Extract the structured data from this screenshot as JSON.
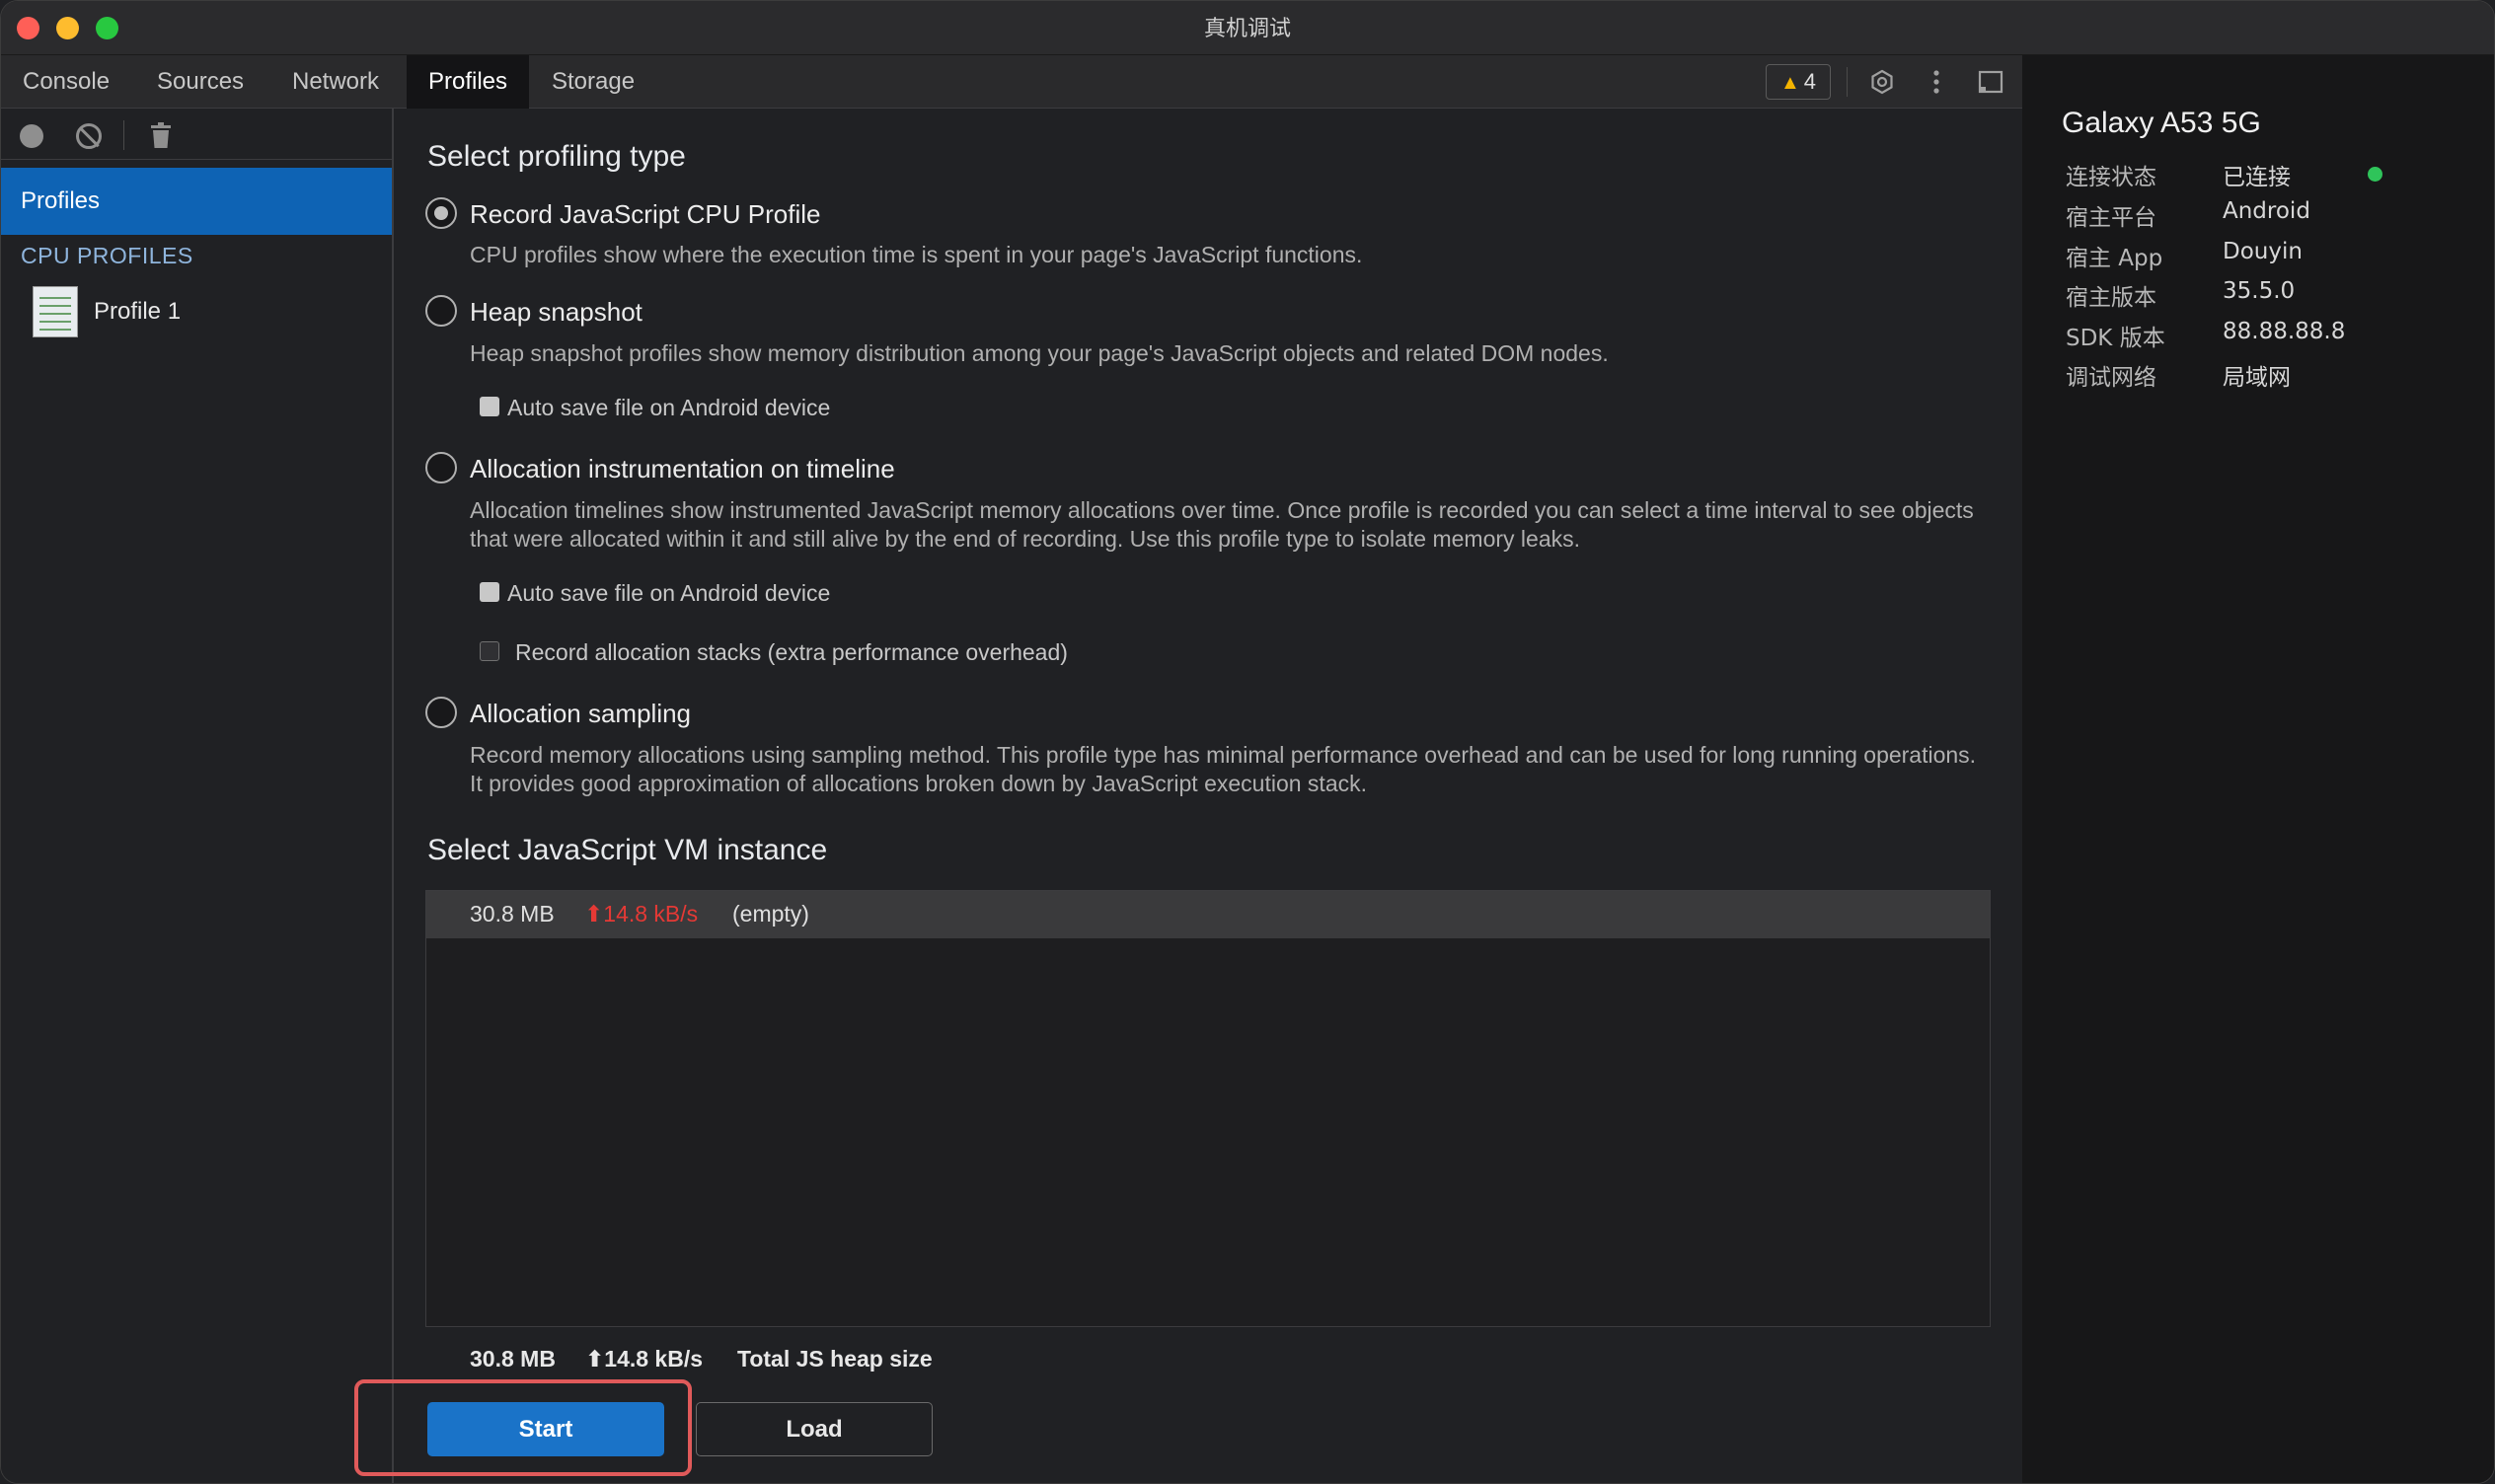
{
  "window": {
    "title": "真机调试"
  },
  "tabs": [
    {
      "label": "Console"
    },
    {
      "label": "Sources"
    },
    {
      "label": "Network"
    },
    {
      "label": "Profiles",
      "active": true
    },
    {
      "label": "Storage"
    }
  ],
  "toolbar": {
    "warning_count": "4",
    "icons": [
      "warning-icon",
      "settings-icon",
      "more-icon",
      "dock-icon"
    ]
  },
  "sidebar": {
    "profiles_label": "Profiles",
    "section_label": "CPU PROFILES",
    "items": [
      {
        "label": "Profile 1"
      }
    ],
    "toolbar_icons": [
      "record-icon",
      "clear-icon",
      "trash-icon"
    ]
  },
  "profiling": {
    "heading": "Select profiling type",
    "options": [
      {
        "label": "Record JavaScript CPU Profile",
        "checked": true,
        "desc": "CPU profiles show where the execution time is spent in your page's JavaScript functions."
      },
      {
        "label": "Heap snapshot",
        "checked": false,
        "desc": "Heap snapshot profiles show memory distribution among your page's JavaScript objects and related DOM nodes.",
        "checkbox": "Auto save file on Android device"
      },
      {
        "label": "Allocation instrumentation on timeline",
        "checked": false,
        "desc": "Allocation timelines show instrumented JavaScript memory allocations over time. Once profile is recorded you can select a time interval to see objects that were allocated within it and still alive by the end of recording. Use this profile type to isolate memory leaks.",
        "checkbox": "Auto save file on Android device",
        "checkbox2": "Record allocation stacks (extra performance overhead)"
      },
      {
        "label": "Allocation sampling",
        "checked": false,
        "desc": "Record memory allocations using sampling method. This profile type has minimal performance overhead and can be used for long running operations. It provides good approximation of allocations broken down by JavaScript execution stack."
      }
    ]
  },
  "vm": {
    "heading": "Select JavaScript VM instance",
    "instance": {
      "size": "30.8 MB",
      "rate": "⬆14.8 kB/s",
      "name": "(empty)"
    },
    "total": {
      "size": "30.8 MB",
      "rate": "⬆14.8 kB/s",
      "label": "Total JS heap size"
    }
  },
  "actions": {
    "start_label": "Start",
    "load_label": "Load"
  },
  "device": {
    "name": "Galaxy A53 5G",
    "rows": [
      {
        "key": "连接状态",
        "value": "已连接",
        "status_color": "#2fc45a"
      },
      {
        "key": "宿主平台",
        "value": "Android"
      },
      {
        "key": "宿主 App",
        "value": "Douyin"
      },
      {
        "key": "宿主版本",
        "value": "35.5.0"
      },
      {
        "key": "SDK 版本",
        "value": "88.88.88.8"
      },
      {
        "key": "调试网络",
        "value": "局域网"
      }
    ]
  },
  "colors": {
    "accent": "#1a73c8",
    "selected": "#0e63b4",
    "rate": "#e53935",
    "highlight": "#e05a5a"
  }
}
